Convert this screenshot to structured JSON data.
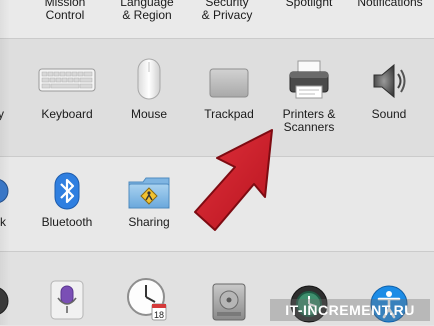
{
  "top_row": [
    {
      "label": "Mission\nControl"
    },
    {
      "label": "Language\n& Region"
    },
    {
      "label": "Security\n& Privacy"
    },
    {
      "label": "Spotlight"
    },
    {
      "label": "Notifications"
    }
  ],
  "hardware": {
    "partial_left_label": "y",
    "items": [
      {
        "label": "Keyboard",
        "icon": "keyboard-icon"
      },
      {
        "label": "Mouse",
        "icon": "mouse-icon"
      },
      {
        "label": "Trackpad",
        "icon": "trackpad-icon"
      },
      {
        "label": "Printers &\nScanners",
        "icon": "printer-icon"
      },
      {
        "label": "Sound",
        "icon": "speaker-icon"
      }
    ]
  },
  "internet": {
    "partial_left_label": "rk",
    "items": [
      {
        "label": "Bluetooth",
        "icon": "bluetooth-icon"
      },
      {
        "label": "Sharing",
        "icon": "sharing-folder-icon"
      }
    ]
  },
  "system": {
    "items": [
      {
        "icon": "dictation-microphone-icon"
      },
      {
        "icon": "date-time-clock-icon",
        "badge": "18"
      },
      {
        "icon": "startup-disk-icon"
      },
      {
        "icon": "time-machine-icon"
      },
      {
        "icon": "accessibility-icon"
      }
    ]
  },
  "watermark": "IT-INCREMENT.RU",
  "colors": {
    "arrow": "#d0202c",
    "bluetooth": "#2f7fe0",
    "accessibility": "#1c8ce6"
  }
}
